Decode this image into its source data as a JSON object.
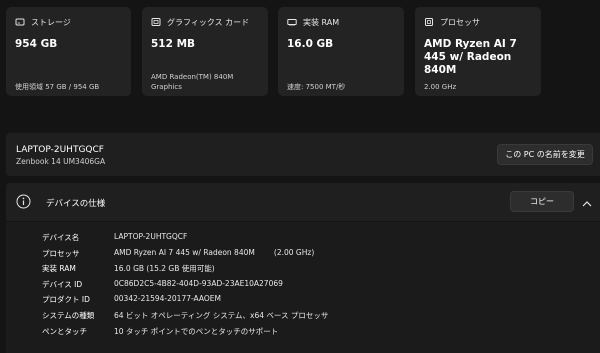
{
  "cards": [
    {
      "icon": "storage-icon",
      "label": "ストレージ",
      "value": "954 GB",
      "sub": "使用領域 57 GB / 954 GB"
    },
    {
      "icon": "graphics-card-icon",
      "label": "グラフィックス カード",
      "value": "512 MB",
      "sub": "AMD Radeon(TM) 840M Graphics"
    },
    {
      "icon": "ram-icon",
      "label": "実装 RAM",
      "value": "16.0 GB",
      "sub": "速度: 7500 MT/秒"
    },
    {
      "icon": "processor-icon",
      "label": "プロセッサ",
      "value": "AMD Ryzen AI 7 445 w/ Radeon 840M",
      "sub": "2.00 GHz"
    }
  ],
  "pc": {
    "name": "LAPTOP-2UHTGQCF",
    "model": "Zenbook 14 UM3406GA",
    "rename_label": "この PC の名前を変更"
  },
  "specs": {
    "title": "デバイスの仕様",
    "copy_label": "コピー",
    "rows": [
      {
        "key": "デバイス名",
        "value": "LAPTOP-2UHTGQCF"
      },
      {
        "key": "プロセッサ",
        "value": "AMD Ryzen AI 7 445 w/ Radeon 840M        (2.00 GHz)"
      },
      {
        "key": "実装 RAM",
        "value": "16.0 GB (15.2 GB 使用可能)"
      },
      {
        "key": "デバイス ID",
        "value": "0C86D2C5-4B82-404D-93AD-23AE10A27069"
      },
      {
        "key": "プロダクト ID",
        "value": "00342-21594-20177-AAOEM"
      },
      {
        "key": "システムの種類",
        "value": "64 ビット オペレーティング システム、x64 ベース プロセッサ"
      },
      {
        "key": "ペンとタッチ",
        "value": "10 タッチ ポイントでのペンとタッチのサポート"
      }
    ]
  }
}
